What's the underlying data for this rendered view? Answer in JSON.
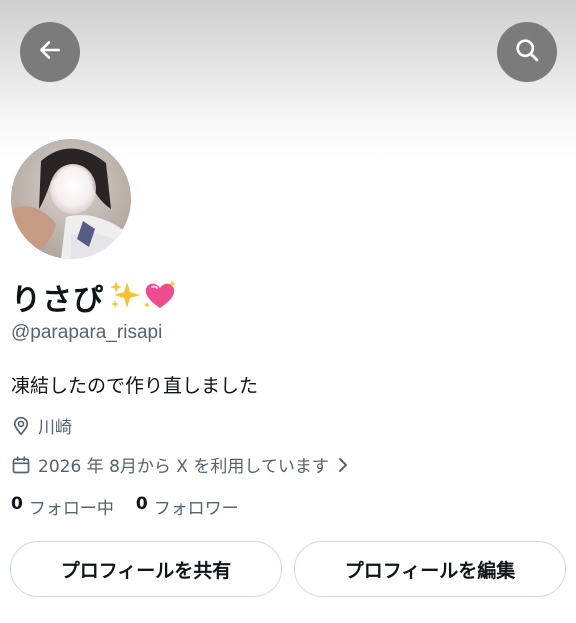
{
  "header": {
    "back_icon": "arrow-left-icon",
    "search_icon": "search-icon",
    "button_color": "#7b7b7b"
  },
  "profile": {
    "display_name": "りさぴ",
    "name_emojis": [
      "sparkles-icon",
      "sparkling-heart-icon"
    ],
    "handle": "@parapara_risapi",
    "bio": "凍結したので作り直しました",
    "location": "川崎",
    "joined": "2026 年 8月から X を利用しています"
  },
  "stats": {
    "following_count": "0",
    "following_label": "フォロー中",
    "followers_count": "0",
    "followers_label": "フォロワー"
  },
  "actions": {
    "share_label": "プロフィールを共有",
    "edit_label": "プロフィールを編集"
  }
}
